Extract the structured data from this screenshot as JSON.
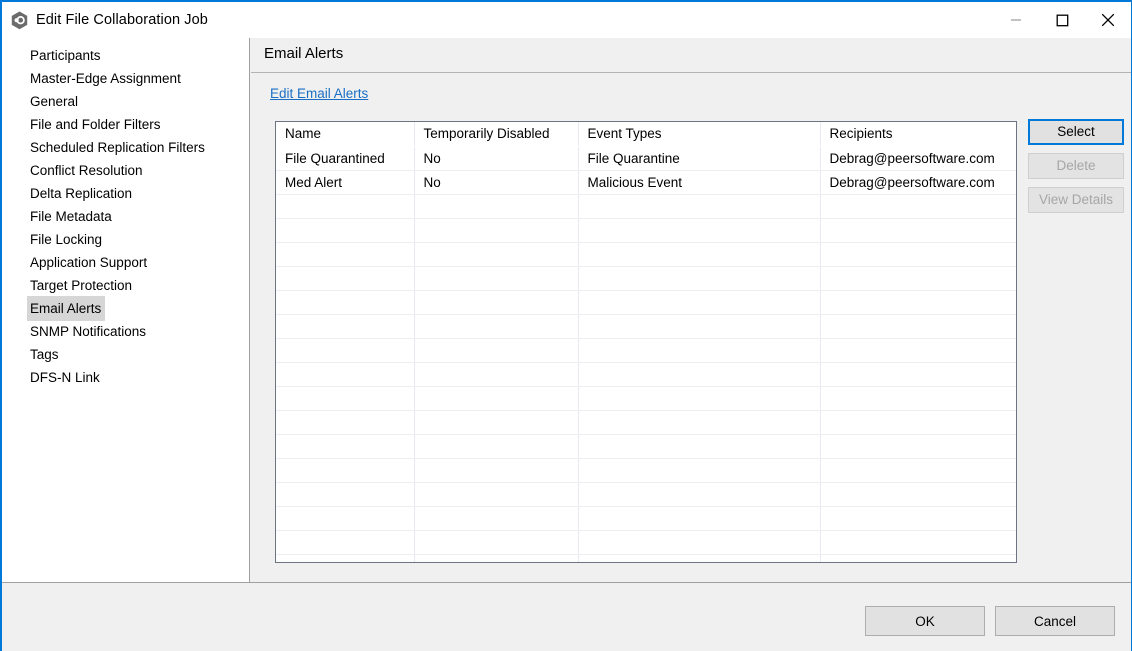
{
  "window": {
    "title": "Edit File Collaboration Job",
    "icon": "peer-hexagon-icon",
    "controls": {
      "minimize": "minimize-icon",
      "maximize": "maximize-icon",
      "close": "close-icon"
    },
    "accent_color": "#0078d7"
  },
  "sidebar": {
    "items": [
      {
        "label": "Participants",
        "selected": false
      },
      {
        "label": "Master-Edge Assignment",
        "selected": false
      },
      {
        "label": "General",
        "selected": false
      },
      {
        "label": "File and Folder Filters",
        "selected": false
      },
      {
        "label": "Scheduled Replication Filters",
        "selected": false
      },
      {
        "label": "Conflict Resolution",
        "selected": false
      },
      {
        "label": "Delta Replication",
        "selected": false
      },
      {
        "label": "File Metadata",
        "selected": false
      },
      {
        "label": "File Locking",
        "selected": false
      },
      {
        "label": "Application Support",
        "selected": false
      },
      {
        "label": "Target Protection",
        "selected": false
      },
      {
        "label": "Email Alerts",
        "selected": true
      },
      {
        "label": "SNMP Notifications",
        "selected": false
      },
      {
        "label": "Tags",
        "selected": false
      },
      {
        "label": "DFS-N Link",
        "selected": false
      }
    ]
  },
  "panel": {
    "title": "Email Alerts",
    "edit_link": "Edit Email Alerts",
    "table": {
      "columns": [
        "Name",
        "Temporarily Disabled",
        "Event Types",
        "Recipients"
      ],
      "rows": [
        {
          "name": "File Quarantined",
          "temporarily_disabled": "No",
          "event_types": "File Quarantine",
          "recipients": "Debrag@peersoftware.com"
        },
        {
          "name": "Med Alert",
          "temporarily_disabled": "No",
          "event_types": "Malicious Event",
          "recipients": "Debrag@peersoftware.com"
        }
      ],
      "empty_row_count": 16
    },
    "buttons": [
      {
        "label": "Select",
        "state": "focused"
      },
      {
        "label": "Delete",
        "state": "disabled"
      },
      {
        "label": "View Details",
        "state": "disabled"
      }
    ]
  },
  "footer": {
    "ok_label": "OK",
    "cancel_label": "Cancel"
  }
}
